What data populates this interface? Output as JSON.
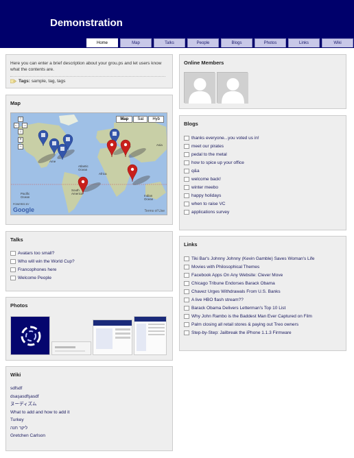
{
  "site": {
    "title": "Demonstration"
  },
  "nav": {
    "tabs": [
      "Home",
      "Map",
      "Talks",
      "People",
      "Blogs",
      "Photos",
      "Links",
      "Wiki"
    ],
    "active": 0
  },
  "description": {
    "text": "Here you can enter a brief description about your grou.ps and let users know what the contents are.",
    "tags_label": "Tags:",
    "tags": "sample, tag, tags"
  },
  "map": {
    "title": "Map",
    "types": [
      "Map",
      "Sat",
      "Hyb"
    ],
    "labels": {
      "asia": "Asia",
      "africa": "Africa",
      "atlantic": "Atlantic Ocean",
      "pacific": "Pacific Ocean",
      "indian": "Indian Ocean",
      "south_america": "South America",
      "america": "Ame"
    },
    "powered_by": "POWERED BY",
    "google": "Google",
    "terms": "Terms of Use",
    "controls": [
      "↑",
      "←",
      "→",
      "↓",
      "+",
      "−"
    ]
  },
  "talks": {
    "title": "Talks",
    "items": [
      "Avatars too small?",
      "Who will win the World Cup?",
      "Francophones here",
      "Welcome People"
    ]
  },
  "photos": {
    "title": "Photos"
  },
  "wiki": {
    "title": "Wiki",
    "items": [
      "sdfsdf",
      "dsaşasdfşasdf",
      "ヌーディズム",
      "What to add and how to add it",
      "Turkey",
      "ליקר חנה",
      "Gretchen Carlson"
    ]
  },
  "online": {
    "title": "Online Members"
  },
  "blogs": {
    "title": "Blogs",
    "items": [
      "thanks everyone...you voted us in!",
      "meet our pirates",
      "pedal to the metal",
      "how to spice up your office",
      "q&a",
      "welcome back!",
      "winter meebo",
      "happy holidays",
      "when to raise VC",
      "applications survey"
    ]
  },
  "links": {
    "title": "Links",
    "items": [
      "Tiki Bar's Johnny Johnny (Kevin Gamble) Saves Woman's Life",
      "Movies with Philosophical Themes",
      "Facebook Apps On Any Website: Clever Move",
      "Chicago Tribune Endorses Barack Obama",
      "Chavez Urges Withdrawals From U.S. Banks",
      "A live HBO flash stream??",
      "Barack Obama Delivers Letterman's Top 10 List",
      "Why John Rambo is the Baddest Man Ever Captured on Film",
      "Palm closing all retail stores & paying out Treo owners",
      "Step-by-Step: Jailbreak the iPhone 1.1.3 Firmware"
    ]
  },
  "colors": {
    "header": "#00006b",
    "panel": "#eeeeee",
    "link": "#1a1a5e",
    "marker_red": "#c8201c",
    "marker_blue": "#3355aa"
  }
}
